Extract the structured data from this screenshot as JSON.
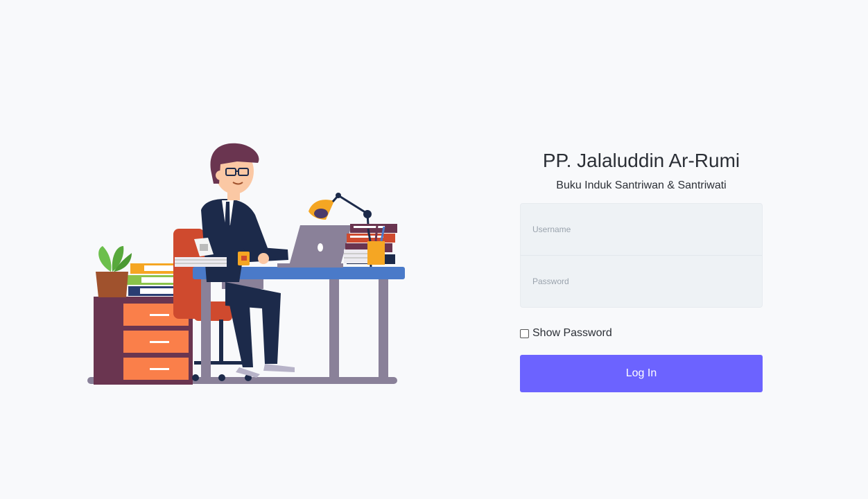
{
  "app": {
    "title": "PP. Jalaluddin Ar-Rumi",
    "subtitle": "Buku Induk Santriwan & Santriwati"
  },
  "form": {
    "username_placeholder": "Username",
    "username_value": "",
    "password_placeholder": "Password",
    "password_value": "",
    "show_password_label": "Show Password",
    "show_password_checked": false,
    "login_label": "Log In"
  },
  "colors": {
    "accent": "#6c63ff",
    "background": "#f8f9fb",
    "field_background": "#eef2f5"
  },
  "illustration": {
    "icon": "office-worker-illustration"
  }
}
